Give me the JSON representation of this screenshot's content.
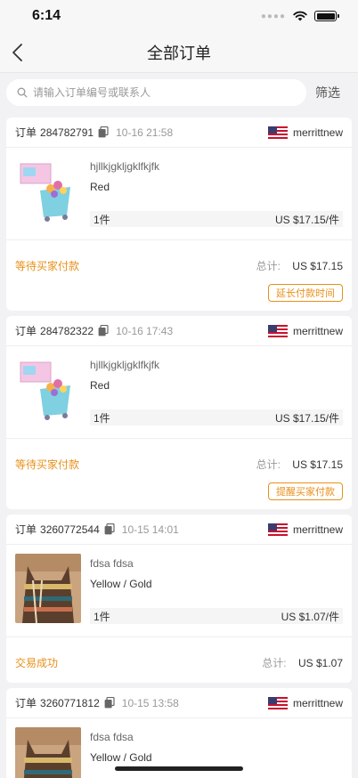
{
  "status_bar": {
    "time": "6:14"
  },
  "nav": {
    "title": "全部订单"
  },
  "search": {
    "placeholder": "请输入订单编号或联系人",
    "filter_label": "筛选"
  },
  "orders": [
    {
      "order_label": "订单",
      "order_no": "284782791",
      "time": "10-16 21:58",
      "seller": "merrittnew",
      "item_title": "hjllkjgkljgklfkjfk",
      "item_variant": "Red",
      "qty": "1件",
      "unit_price": "US $17.15/件",
      "status": "等待买家付款",
      "total_label": "总计:",
      "total": "US $17.15",
      "action": "延长付款时间",
      "thumb": "toy-icon"
    },
    {
      "order_label": "订单",
      "order_no": "284782322",
      "time": "10-16 17:43",
      "seller": "merrittnew",
      "item_title": "hjllkjgkljgklfkjfk",
      "item_variant": "Red",
      "qty": "1件",
      "unit_price": "US $17.15/件",
      "status": "等待买家付款",
      "total_label": "总计:",
      "total": "US $17.15",
      "action": "提醒买家付款",
      "thumb": "toy-icon"
    },
    {
      "order_label": "订单",
      "order_no": "3260772544",
      "time": "10-15 14:01",
      "seller": "merrittnew",
      "item_title": "fdsa fdsa",
      "item_variant": "Yellow / Gold",
      "qty": "1件",
      "unit_price": "US $1.07/件",
      "status": "交易成功",
      "total_label": "总计:",
      "total": "US $1.07",
      "thumb": "dress-icon"
    },
    {
      "order_label": "订单",
      "order_no": "3260771812",
      "time": "10-15 13:58",
      "seller": "merrittnew",
      "item_title": "fdsa fdsa",
      "item_variant": "Yellow / Gold",
      "thumb": "dress-icon"
    }
  ],
  "colors": {
    "accent": "#e8901a",
    "background": "#f2f2f4"
  }
}
